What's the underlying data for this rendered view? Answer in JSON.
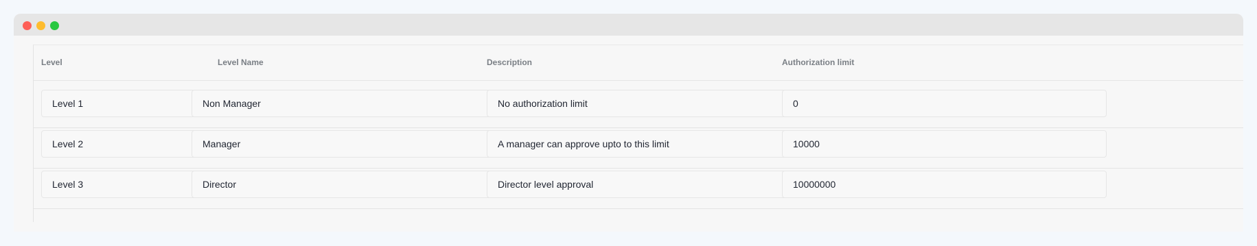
{
  "table": {
    "headers": {
      "level": "Level",
      "level_name": "Level Name",
      "description": "Description",
      "authorization_limit": "Authorization limit"
    },
    "rows": [
      {
        "level": "Level 1",
        "level_name": "Non Manager",
        "description": "No authorization limit",
        "authorization_limit": "0"
      },
      {
        "level": "Level 2",
        "level_name": "Manager",
        "description": "A manager can approve upto to this limit",
        "authorization_limit": "10000"
      },
      {
        "level": "Level 3",
        "level_name": "Director",
        "description": "Director level approval",
        "authorization_limit": "10000000"
      }
    ]
  },
  "colors": {
    "window_close": "#fe5f57",
    "window_minimize": "#febc2e",
    "window_maximize": "#28c840"
  }
}
